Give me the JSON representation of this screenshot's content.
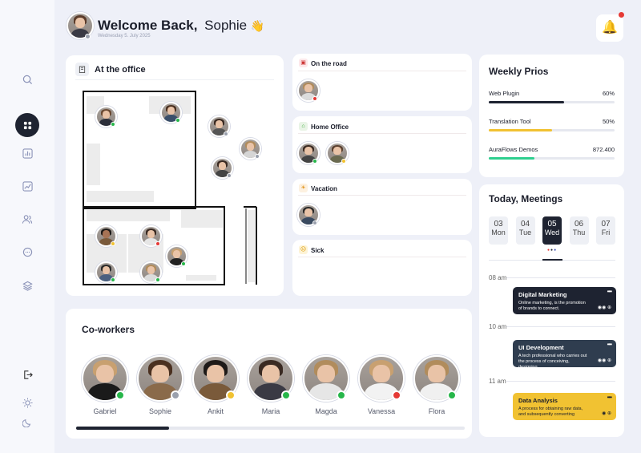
{
  "header": {
    "greeting": "Welcome Back,",
    "user_name": "Sophie",
    "wave": "👋",
    "date": "Wednesday 5. July 2025",
    "bell": "🔔"
  },
  "sidebar": {
    "icons": [
      "search-icon",
      "dashboard-icon",
      "chart-icon",
      "trend-icon",
      "users-icon",
      "chat-icon",
      "layers-icon"
    ],
    "bottom_icons": [
      "logout-icon",
      "sun-icon",
      "moon-icon"
    ]
  },
  "office": {
    "title": "At the office"
  },
  "status": {
    "on_the_road": "On the road",
    "home_office": "Home Office",
    "vacation": "Vacation",
    "sick": "Sick"
  },
  "coworkers": {
    "title": "Co-workers",
    "people": [
      {
        "name": "Gabriel",
        "status": "green"
      },
      {
        "name": "Sophie",
        "status": "gray"
      },
      {
        "name": "Ankit",
        "status": "yellow"
      },
      {
        "name": "Maria",
        "status": "green"
      },
      {
        "name": "Magda",
        "status": "green"
      },
      {
        "name": "Vanessa",
        "status": "red"
      },
      {
        "name": "Flora",
        "status": "green"
      }
    ],
    "scroll_progress": 0.24
  },
  "prios": {
    "title": "Weekly Prios",
    "items": [
      {
        "label": "Web Plugin",
        "value": "60%",
        "progress": 0.6,
        "color": "#1e2331"
      },
      {
        "label": "Translation Tool",
        "value": "50%",
        "progress": 0.5,
        "color": "#f1c232"
      },
      {
        "label": "AuraFlows Demos",
        "value": "872.400",
        "progress": 0.36,
        "color": "#2ecf8f"
      }
    ]
  },
  "meetings": {
    "title": "Today, Meetings",
    "days": [
      {
        "num": "03",
        "label": "Mon"
      },
      {
        "num": "04",
        "label": "Tue"
      },
      {
        "num": "05",
        "label": "Wed"
      },
      {
        "num": "06",
        "label": "Thu"
      },
      {
        "num": "07",
        "label": "Fri"
      }
    ],
    "times": [
      "08 am",
      "10 am",
      "11 am"
    ],
    "events": [
      {
        "title": "Digital Marketing",
        "desc": "Online marketing, is the promotion of brands to connect.",
        "more": "•••",
        "color": "#1e2331"
      },
      {
        "title": "UI Development",
        "desc": "A tech professional who carries out the process of conceiving, designing",
        "more": "•••",
        "color": "#2f3d4f"
      },
      {
        "title": "Data Analysis",
        "desc": "A process for obtaining raw data, and subsequently converting",
        "more": "•••",
        "color": "#f1c232"
      }
    ]
  },
  "colors": {
    "accent": "#1e2331",
    "online": "#27b64a",
    "away": "#f1c232",
    "busy": "#e53935",
    "offline": "#9aa0ad"
  }
}
